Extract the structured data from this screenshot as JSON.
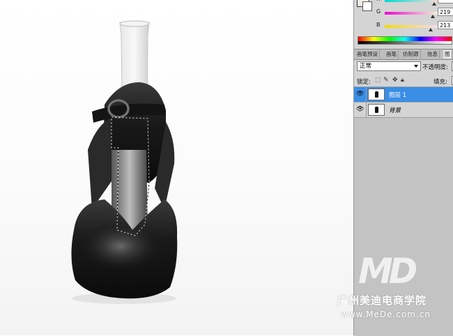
{
  "color_panel": {
    "r_label": "R",
    "g_label": "G",
    "g_value": "219",
    "b_label": "B",
    "b_value": "213"
  },
  "panel_tabs": [
    "画笔预设",
    "画笔",
    "仿制源",
    "信息",
    "图"
  ],
  "layers_panel": {
    "blend_mode": "正常",
    "opacity_label": "不透明度:",
    "lock_label": "锁定:",
    "fill_label": "填充:",
    "layers": [
      {
        "name": "图层 1",
        "selected": true
      },
      {
        "name": "背景",
        "selected": false
      }
    ]
  },
  "watermark": {
    "logo": "MD",
    "school": "广州美迪电商学院",
    "url": "www.MeDe.com.cn"
  },
  "colors": {
    "selection": "#3a8ee6",
    "panel_bg": "#d4d4d4",
    "shoe": "#1a1a1a"
  }
}
